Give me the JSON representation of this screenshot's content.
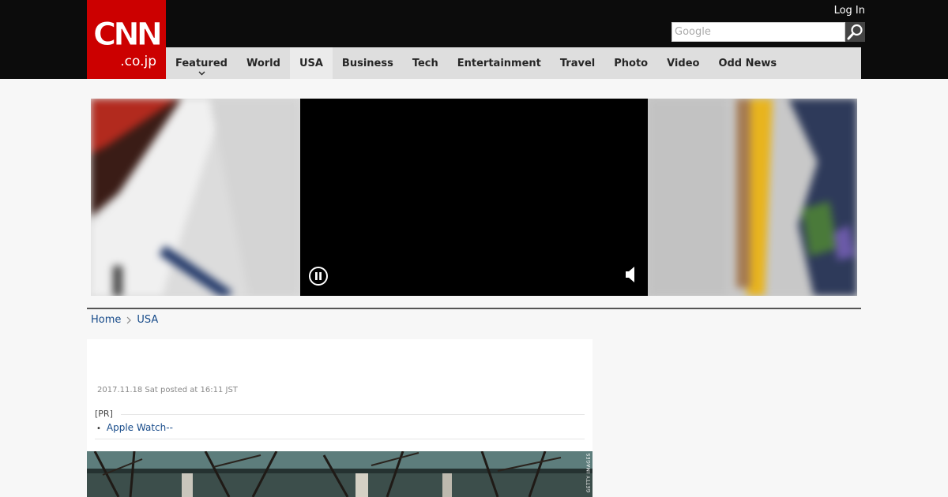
{
  "brand": {
    "logo_text": "CNN",
    "logo_sub": ".co.jp"
  },
  "header": {
    "login_label": "Log In",
    "search": {
      "placeholder": "Google",
      "value": ""
    }
  },
  "nav": {
    "items": [
      {
        "label": "Featured"
      },
      {
        "label": "World"
      },
      {
        "label": "USA"
      },
      {
        "label": "Business"
      },
      {
        "label": "Tech"
      },
      {
        "label": "Entertainment"
      },
      {
        "label": "Travel"
      },
      {
        "label": "Photo"
      },
      {
        "label": "Video"
      },
      {
        "label": "Odd News"
      }
    ],
    "active": "USA"
  },
  "breadcrumb": {
    "home": "Home",
    "current": "USA"
  },
  "article": {
    "posted": "2017.11.18 Sat posted at 16:11 JST",
    "pr_label": "[PR]",
    "pr_link": "Apple Watch--",
    "photo_credit": "GETTY IMAGES"
  },
  "colors": {
    "brand_red": "#cc0000",
    "topbar": "#0c0c0c",
    "nav_bg": "#dedede",
    "link": "#174b8a"
  },
  "icons": {
    "search": "magnifier-icon",
    "pause": "pause-circle-icon",
    "mute": "speaker-icon",
    "nav_caret": "chevron-down-icon",
    "breadcrumb_sep": "chevron-right-icon"
  }
}
